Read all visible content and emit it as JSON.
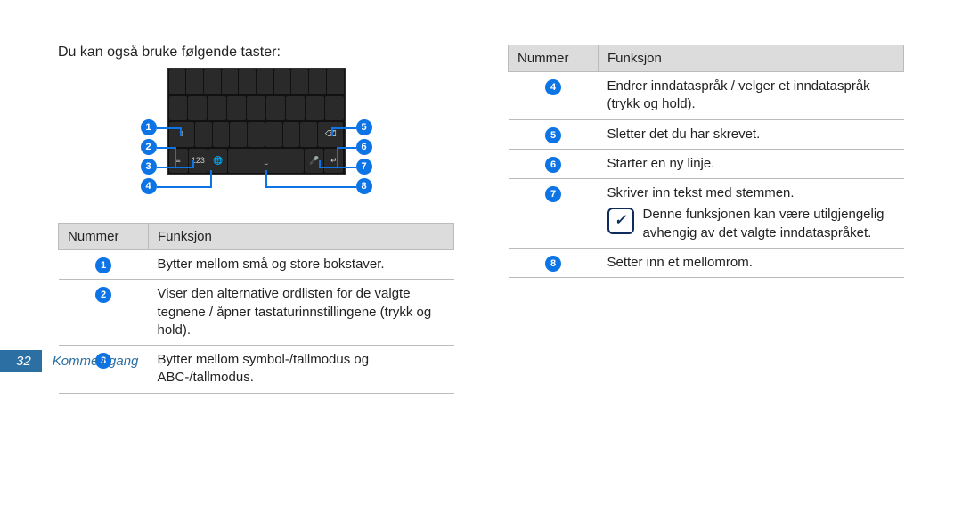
{
  "intro": "Du kan også bruke følgende taster:",
  "columns": {
    "num": "Nummer",
    "func": "Funksjon"
  },
  "rows_left": [
    {
      "n": "1",
      "t": "Bytter mellom små og store bokstaver."
    },
    {
      "n": "2",
      "t": "Viser den alternative ordlisten for de valgte tegnene / åpner tastaturinnstillingene (trykk og hold)."
    },
    {
      "n": "3",
      "t": "Bytter mellom symbol-/tallmodus og ABC-/tallmodus."
    }
  ],
  "rows_right": [
    {
      "n": "4",
      "t": "Endrer inndataspråk / velger et inndataspråk (trykk og hold)."
    },
    {
      "n": "5",
      "t": "Sletter det du har skrevet."
    },
    {
      "n": "6",
      "t": "Starter en ny linje."
    },
    {
      "n": "7",
      "t": "Skriver inn tekst med stemmen.",
      "note": "Denne funksjonen kan være utilgjengelig avhengig av det valgte inndataspråket."
    },
    {
      "n": "8",
      "t": "Setter inn et mellomrom."
    }
  ],
  "callouts": [
    "1",
    "2",
    "3",
    "4",
    "5",
    "6",
    "7",
    "8"
  ],
  "footer": {
    "page": "32",
    "section": "Komme i gang"
  }
}
